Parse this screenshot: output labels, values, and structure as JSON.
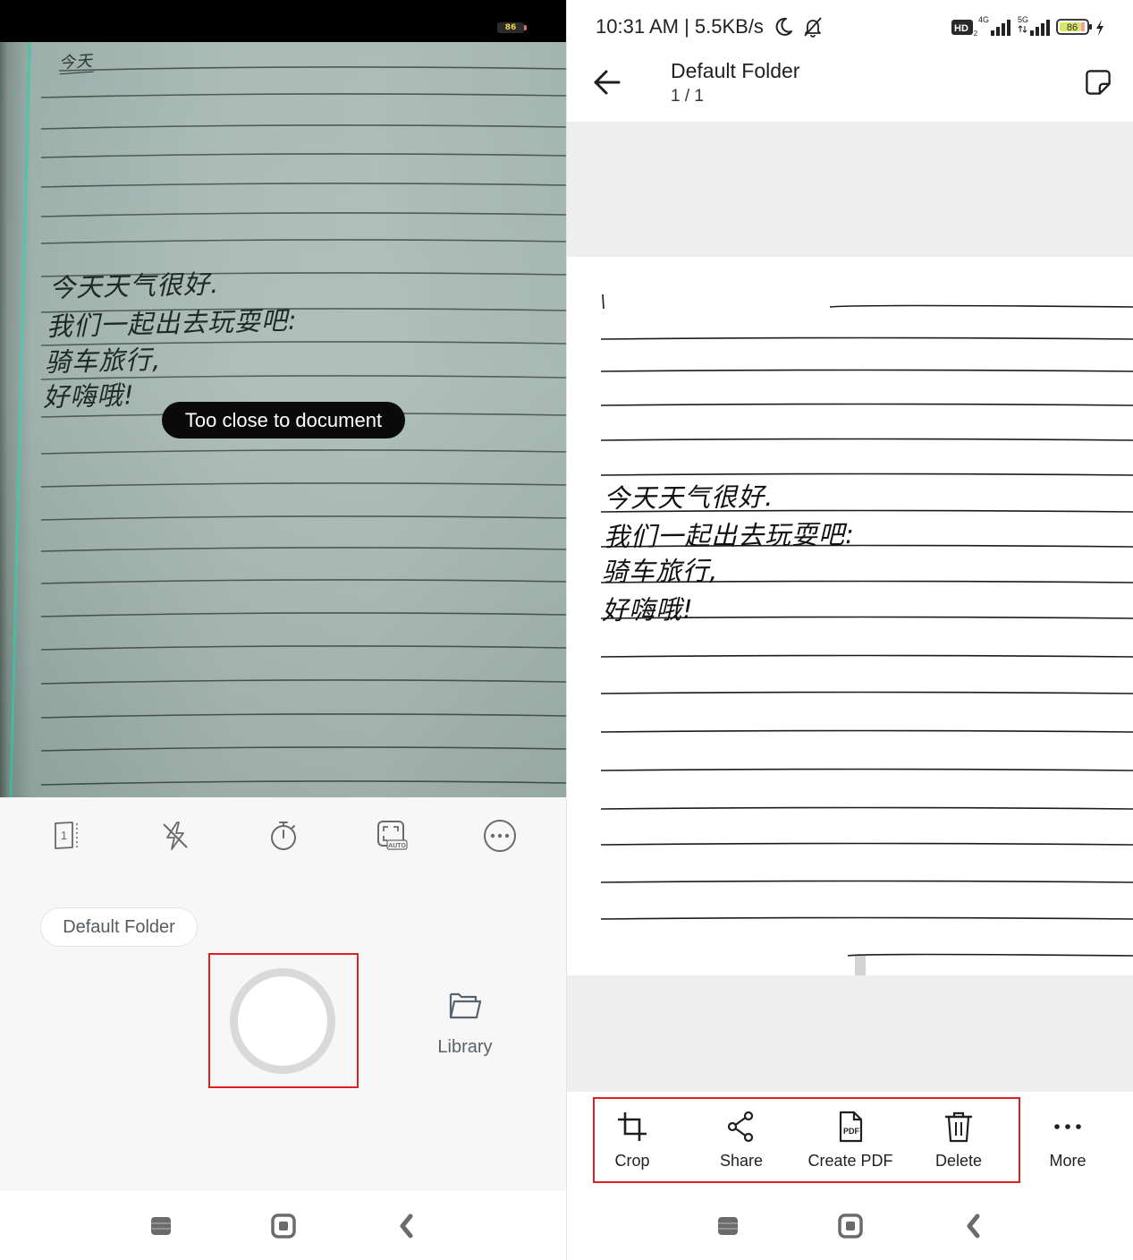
{
  "left": {
    "status_bar": {
      "battery": "86"
    },
    "camera": {
      "corner_note": "今天",
      "handwriting": [
        "今天天气很好.",
        "我们一起出去玩耍吧:",
        "骑车旅行,",
        "好嗨哦!"
      ],
      "toast": "Too close to document"
    },
    "toolbar": {
      "page_count": "1",
      "auto_badge": "AUTO",
      "icons": [
        "page-count-icon",
        "flash-off-icon",
        "timer-icon",
        "auto-capture-icon",
        "more-options-icon"
      ]
    },
    "folder_chip": "Default Folder",
    "library": {
      "label": "Library",
      "icon": "folder-icon"
    },
    "nav_icons": [
      "recent-apps-icon",
      "home-icon",
      "back-icon"
    ]
  },
  "right": {
    "status_bar": {
      "time_speed": "10:31 AM | 5.5KB/s",
      "hd": "HD",
      "hd_sub": "2",
      "net_1": "4G",
      "net_2": "5G",
      "battery": "86"
    },
    "header": {
      "title": "Default Folder",
      "subtitle": "1 / 1",
      "back_icon": "arrow-left-icon",
      "note_icon": "sticky-note-icon"
    },
    "document": {
      "handwriting": [
        "今天天气很好.",
        "我们一起出去玩耍吧:",
        "骑车旅行,",
        "好嗨哦!"
      ]
    },
    "actions": [
      {
        "label": "Crop",
        "icon": "crop-icon"
      },
      {
        "label": "Share",
        "icon": "share-icon"
      },
      {
        "label": "Create PDF",
        "icon": "pdf-icon",
        "badge": "PDF"
      },
      {
        "label": "Delete",
        "icon": "trash-icon"
      },
      {
        "label": "More",
        "icon": "more-horizontal-icon"
      }
    ],
    "nav_icons": [
      "recent-apps-icon",
      "home-icon",
      "back-icon"
    ]
  },
  "colors": {
    "highlight": "#e0201e",
    "toast_bg": "#0a0a0a",
    "paper_tint": "#a7b9b3",
    "viewer_bg": "#eeeeee"
  }
}
